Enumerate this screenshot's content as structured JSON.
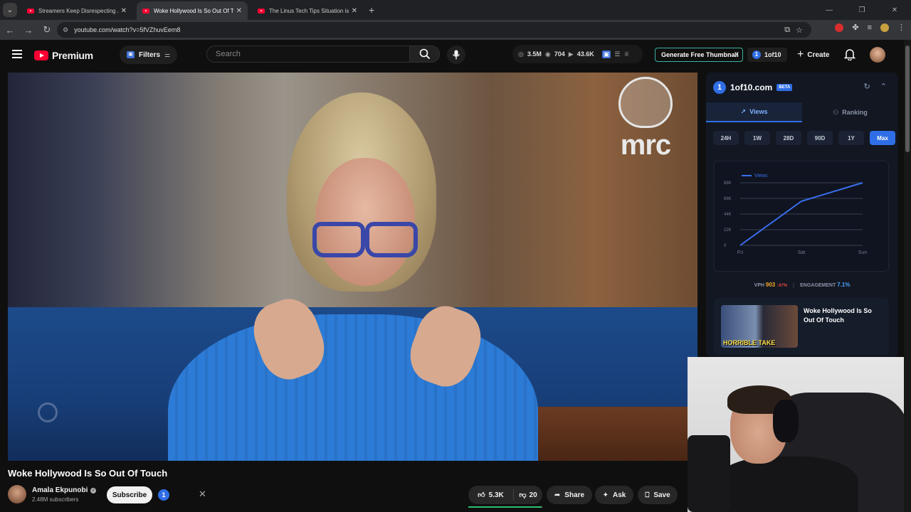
{
  "browser": {
    "tabs": [
      {
        "title": "Streamers Keep Disrespecting J",
        "active": false
      },
      {
        "title": "Woke Hollywood Is So Out Of T",
        "active": true
      },
      {
        "title": "The Linus Tech Tips Situation is",
        "active": false
      }
    ],
    "url": "youtube.com/watch?v=5fVZhuvEem8"
  },
  "masthead": {
    "brand": "Premium",
    "filters_label": "Filters",
    "search_placeholder": "Search",
    "stats": {
      "subscribers": "3.5M",
      "videos": "704",
      "avg_views": "43.6K"
    },
    "generate_thumbnail": "Generate Free Thumbnail",
    "ext_label": "1of10",
    "create_label": "Create"
  },
  "video": {
    "title": "Woke Hollywood Is So Out Of Touch",
    "channel": "Amala Ekpunobi",
    "subscribers": "2.48M subscribers",
    "subscribe_label": "Subscribe",
    "likes": "5.3K",
    "dislikes": "20",
    "like_ratio": 0.99,
    "share_label": "Share",
    "ask_label": "Ask",
    "save_label": "Save",
    "watermark": "mrc"
  },
  "panel": {
    "name": "1of10.com",
    "beta": "BETA",
    "tabs": [
      "Views",
      "Ranking"
    ],
    "ranges": [
      "24H",
      "1W",
      "28D",
      "90D",
      "1Y",
      "Max"
    ],
    "selected_range": "Max",
    "vph_label": "VPH",
    "vph_value": "903",
    "vph_change": "↓67%",
    "engagement_label": "ENGAGEMENT",
    "engagement_value": "7.1%",
    "video_card_title": "Woke Hollywood Is So Out Of Touch",
    "thumb_text": "HORRIBLE TAKE"
  },
  "chart_data": {
    "type": "line",
    "series": [
      {
        "name": "Views",
        "values": [
          0,
          62000,
          88000
        ]
      }
    ],
    "categories": [
      "Fri",
      "Sat",
      "Sun"
    ],
    "yticks": [
      "0",
      "22K",
      "44K",
      "66K",
      "88K"
    ],
    "ylim": [
      0,
      88000
    ],
    "legend": "top-left",
    "grid": true,
    "line_color": "#3b6ff0"
  }
}
